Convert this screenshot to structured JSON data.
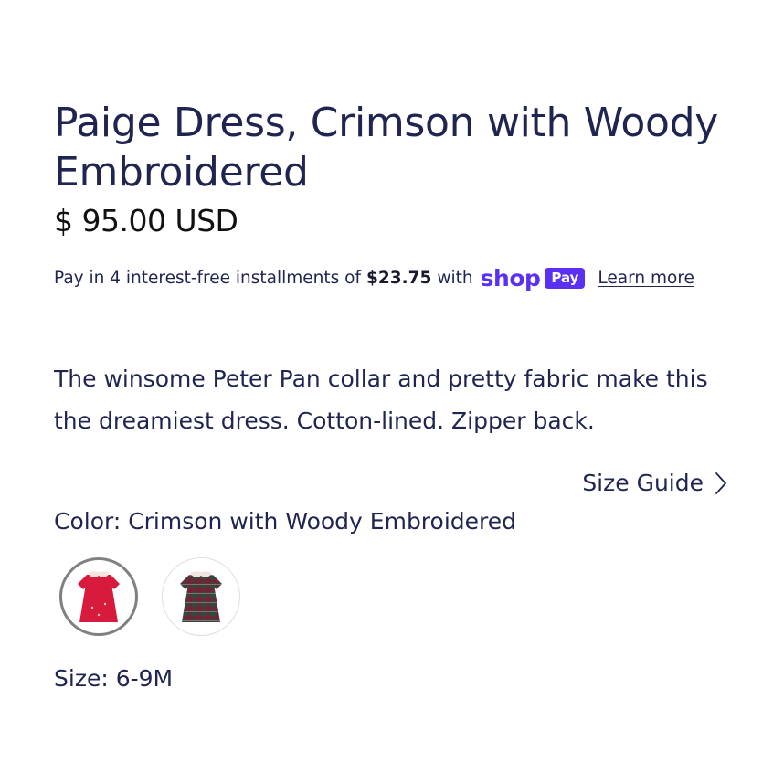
{
  "product": {
    "title": "Paige Dress, Crimson with Woody Embroidered",
    "price": "$ 95.00 USD"
  },
  "shop_pay": {
    "text_before": "Pay in 4 interest-free installments of",
    "amount": "$23.75",
    "text_after": "with",
    "logo_word": "shop",
    "badge": "Pay",
    "learn_more": "Learn more",
    "brand_color": "#5a31f4"
  },
  "description": "The winsome Peter Pan collar and pretty fabric make this the dreamiest dress. Cotton-lined. Zipper back.",
  "size_guide": {
    "label": "Size Guide",
    "icon": "chevron-right-icon"
  },
  "color": {
    "label": "Color: Crimson with Woody Embroidered",
    "swatches": [
      {
        "name": "crimson-dress",
        "selected": true,
        "color": "#d81b3c"
      },
      {
        "name": "plaid-dress",
        "selected": false,
        "color": "#3b3f46"
      }
    ]
  },
  "size": {
    "label": "Size: 6-9M"
  },
  "colors": {
    "text": "#1f2550",
    "price": "#111111",
    "accent": "#5a31f4"
  }
}
